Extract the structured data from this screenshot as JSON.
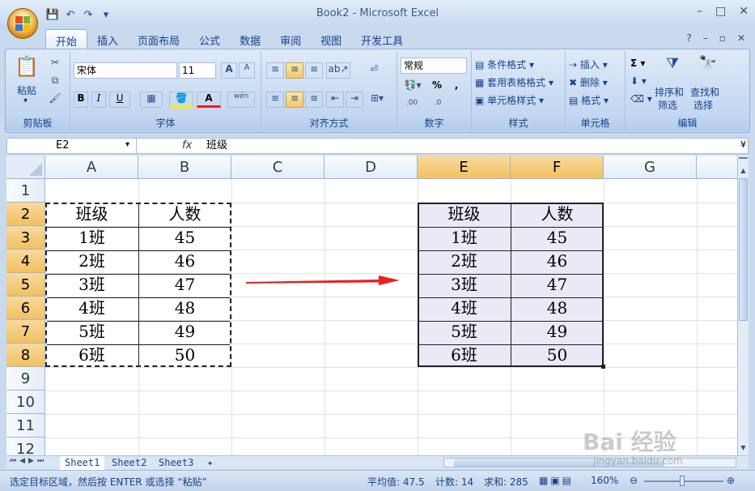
{
  "window": {
    "title": "Book2 - Microsoft Excel"
  },
  "tabs": [
    "开始",
    "插入",
    "页面布局",
    "公式",
    "数据",
    "审阅",
    "视图",
    "开发工具"
  ],
  "ribbon": {
    "clipboard": {
      "paste": "粘贴",
      "label": "剪贴板"
    },
    "font": {
      "name": "宋体",
      "size": "11",
      "label": "字体",
      "bold": "B",
      "italic": "I",
      "underline": "U",
      "grow": "A",
      "shrink": "A",
      "color": "A",
      "phonetic": "wén"
    },
    "alignment": {
      "label": "对齐方式"
    },
    "number": {
      "format": "常规",
      "label": "数字",
      "percent": "%",
      "comma": ","
    },
    "styles": {
      "conditional": "条件格式",
      "table": "套用表格格式",
      "cell": "单元格样式",
      "label": "样式"
    },
    "cells": {
      "insert": "插入",
      "delete": "删除",
      "format": "格式",
      "label": "单元格"
    },
    "editing": {
      "sigma": "Σ",
      "sort": "排序和",
      "sort2": "筛选",
      "find": "查找和",
      "find2": "选择",
      "label": "编辑"
    }
  },
  "formula_bar": {
    "name_box": "E2",
    "fx": "fx",
    "content": "班级"
  },
  "columns": [
    "A",
    "B",
    "C",
    "D",
    "E",
    "F",
    "G"
  ],
  "rows": [
    "1",
    "2",
    "3",
    "4",
    "5",
    "6",
    "7",
    "8",
    "9",
    "10",
    "11",
    "12"
  ],
  "left_table": {
    "header": [
      "班级",
      "人数"
    ],
    "rows": [
      [
        "1班",
        "45"
      ],
      [
        "2班",
        "46"
      ],
      [
        "3班",
        "47"
      ],
      [
        "4班",
        "48"
      ],
      [
        "5班",
        "49"
      ],
      [
        "6班",
        "50"
      ]
    ]
  },
  "right_table": {
    "header": [
      "班级",
      "人数"
    ],
    "rows": [
      [
        "1班",
        "45"
      ],
      [
        "2班",
        "46"
      ],
      [
        "3班",
        "47"
      ],
      [
        "4班",
        "48"
      ],
      [
        "5班",
        "49"
      ],
      [
        "6班",
        "50"
      ]
    ]
  },
  "sheets": [
    "Sheet1",
    "Sheet2",
    "Sheet3"
  ],
  "status": {
    "message": "选定目标区域，然后按 ENTER 或选择 “粘贴”",
    "average": "平均值: 47.5",
    "count": "计数: 14",
    "sum": "求和: 285",
    "zoom": "160%"
  },
  "watermark": {
    "main": "Bai 经验",
    "sub": "jingyan.baidu.com"
  },
  "colors": {
    "accent": "#15428b",
    "arrow": "#e8201e",
    "selected_header": "#f1c15f",
    "selected_fill": "#eae9f6"
  }
}
